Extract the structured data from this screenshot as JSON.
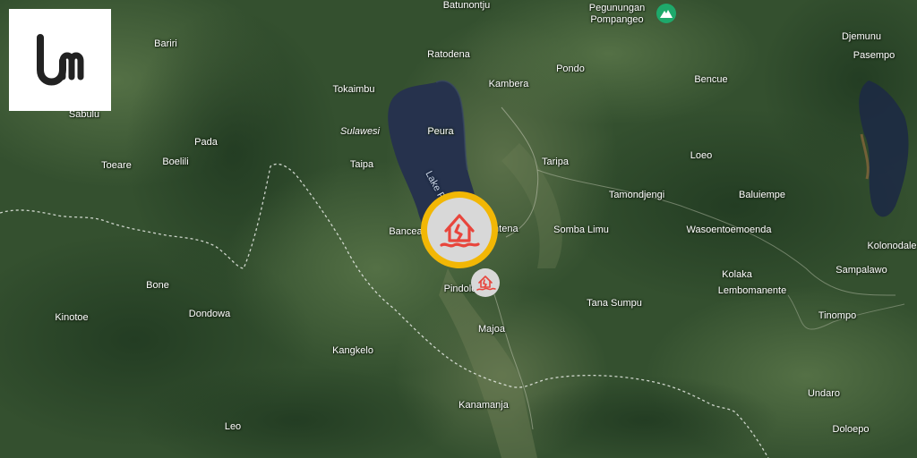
{
  "map": {
    "lake_label": "Lake Poso",
    "places": [
      {
        "name": "Batunontju",
        "style": "normal"
      },
      {
        "name": "Pegunungan",
        "style": "normal"
      },
      {
        "name": "Pompangeo",
        "style": "normal"
      },
      {
        "name": "Djemunu",
        "style": "normal"
      },
      {
        "name": "Pasempo",
        "style": "normal"
      },
      {
        "name": "Bariri",
        "style": "normal"
      },
      {
        "name": "Ratodena",
        "style": "normal"
      },
      {
        "name": "Pondo",
        "style": "normal"
      },
      {
        "name": "Bencue",
        "style": "normal"
      },
      {
        "name": "Tokaimbu",
        "style": "normal"
      },
      {
        "name": "Kambera",
        "style": "normal"
      },
      {
        "name": "Sabulu",
        "style": "normal"
      },
      {
        "name": "Peura",
        "style": "normal"
      },
      {
        "name": "Sulawesi",
        "style": "italic"
      },
      {
        "name": "Pada",
        "style": "normal"
      },
      {
        "name": "Toeare",
        "style": "normal"
      },
      {
        "name": "Boelili",
        "style": "normal"
      },
      {
        "name": "Taipa",
        "style": "normal"
      },
      {
        "name": "Taripa",
        "style": "normal"
      },
      {
        "name": "Loeo",
        "style": "normal"
      },
      {
        "name": "Tamondjengi",
        "style": "normal"
      },
      {
        "name": "Baluiempe",
        "style": "normal"
      },
      {
        "name": "Bancea",
        "style": "normal"
      },
      {
        "name": "Tentena",
        "style": "normal"
      },
      {
        "name": "Somba Limu",
        "style": "normal"
      },
      {
        "name": "Wasoentoemoenda",
        "style": "normal"
      },
      {
        "name": "Kolonodale",
        "style": "normal"
      },
      {
        "name": "Kolaka",
        "style": "normal"
      },
      {
        "name": "Sampalawo",
        "style": "normal"
      },
      {
        "name": "Bone",
        "style": "normal"
      },
      {
        "name": "Pindolo",
        "style": "normal"
      },
      {
        "name": "Lembomanente",
        "style": "normal"
      },
      {
        "name": "Kinotoe",
        "style": "normal"
      },
      {
        "name": "Dondowa",
        "style": "normal"
      },
      {
        "name": "Tana Sumpu",
        "style": "normal"
      },
      {
        "name": "Tinompo",
        "style": "normal"
      },
      {
        "name": "Majoa",
        "style": "normal"
      },
      {
        "name": "Kangkelo",
        "style": "normal"
      },
      {
        "name": "Undaro",
        "style": "normal"
      },
      {
        "name": "Kanamanja",
        "style": "normal"
      },
      {
        "name": "Leo",
        "style": "normal"
      },
      {
        "name": "Doloepo",
        "style": "normal"
      }
    ]
  },
  "markers": {
    "primary_icon": "house-damage-icon",
    "secondary_icon": "house-damage-icon",
    "ring_color": "#f2b705",
    "icon_color": "#e8453c"
  },
  "logo": {
    "icon": "um-logo-icon"
  },
  "colors": {
    "land_dark": "#2a4426",
    "land_mid": "#3d5b35",
    "land_light": "#58774a",
    "lake": "#25334f",
    "boundary": "#e9ece6"
  }
}
